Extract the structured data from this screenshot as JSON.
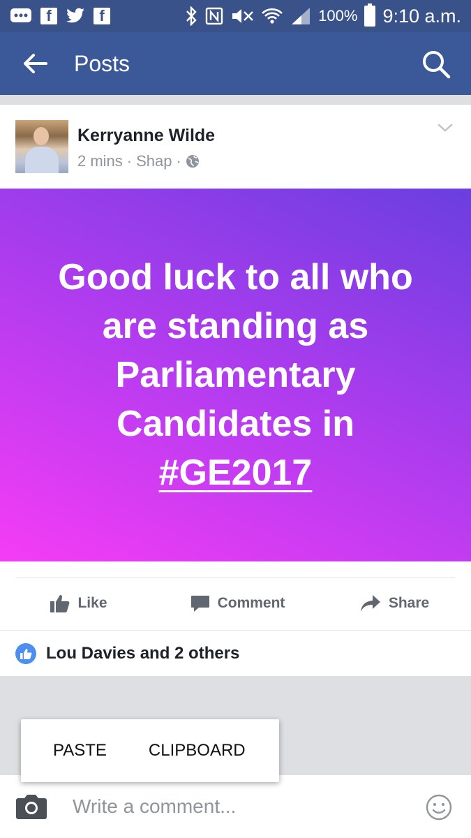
{
  "status_bar": {
    "battery": "100%",
    "time": "9:10 a.m."
  },
  "app_bar": {
    "title": "Posts"
  },
  "post": {
    "author": "Kerryanne Wilde",
    "time": "2 mins",
    "location": "Shap",
    "separator": "·",
    "text_line1": "Good luck to all who are standing as Parliamentary Candidates in ",
    "hashtag": "#GE2017",
    "background_colors": [
      "#f53cf5",
      "#b73cf0",
      "#6a3ee0"
    ]
  },
  "actions": {
    "like": "Like",
    "comment": "Comment",
    "share": "Share"
  },
  "reactions": {
    "text": "Lou Davies and 2 others"
  },
  "clipboard_popup": {
    "paste": "PASTE",
    "clipboard": "CLIPBOARD"
  },
  "comment_bar": {
    "placeholder": "Write a comment..."
  },
  "colors": {
    "brand": "#3b5998",
    "status_bar": "#39538a",
    "like_blue": "#4c8ff0"
  }
}
